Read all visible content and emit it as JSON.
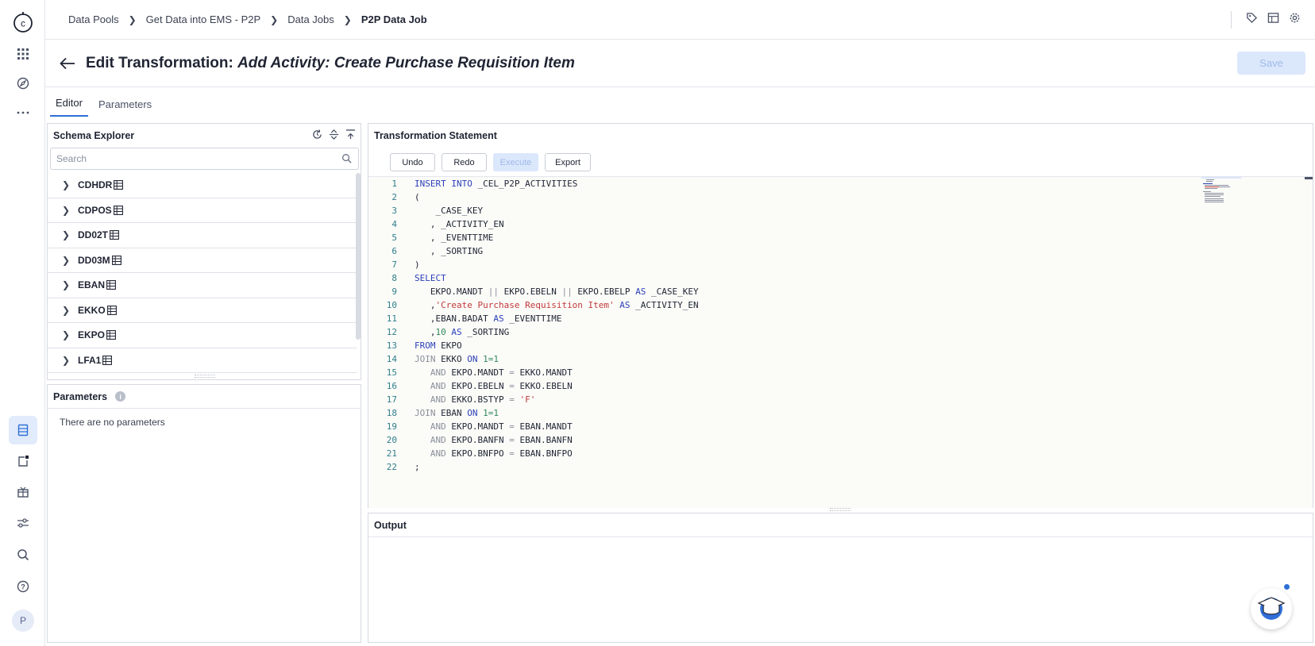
{
  "breadcrumb": {
    "items": [
      "Data Pools",
      "Get Data into EMS - P2P",
      "Data Jobs"
    ],
    "current": "P2P Data Job"
  },
  "header": {
    "title_prefix": "Edit Transformation: ",
    "title_name": "Add Activity: Create Purchase Requisition Item",
    "save_label": "Save"
  },
  "tabs": [
    "Editor",
    "Parameters"
  ],
  "schema": {
    "title": "Schema Explorer",
    "search_placeholder": "Search",
    "tables": [
      "CDHDR",
      "CDPOS",
      "DD02T",
      "DD03M",
      "EBAN",
      "EKKO",
      "EKPO",
      "LFA1"
    ]
  },
  "params": {
    "title": "Parameters",
    "empty": "There are no parameters"
  },
  "editor": {
    "title": "Transformation Statement",
    "undo": "Undo",
    "redo": "Redo",
    "execute": "Execute",
    "export": "Export"
  },
  "output": {
    "title": "Output"
  },
  "user": {
    "initial": "P"
  },
  "colors": {
    "accent": "#2f6fd6",
    "disabled_bg": "#dbe7fb",
    "keyword": "#2b3fb8",
    "string": "#c23a3a"
  }
}
